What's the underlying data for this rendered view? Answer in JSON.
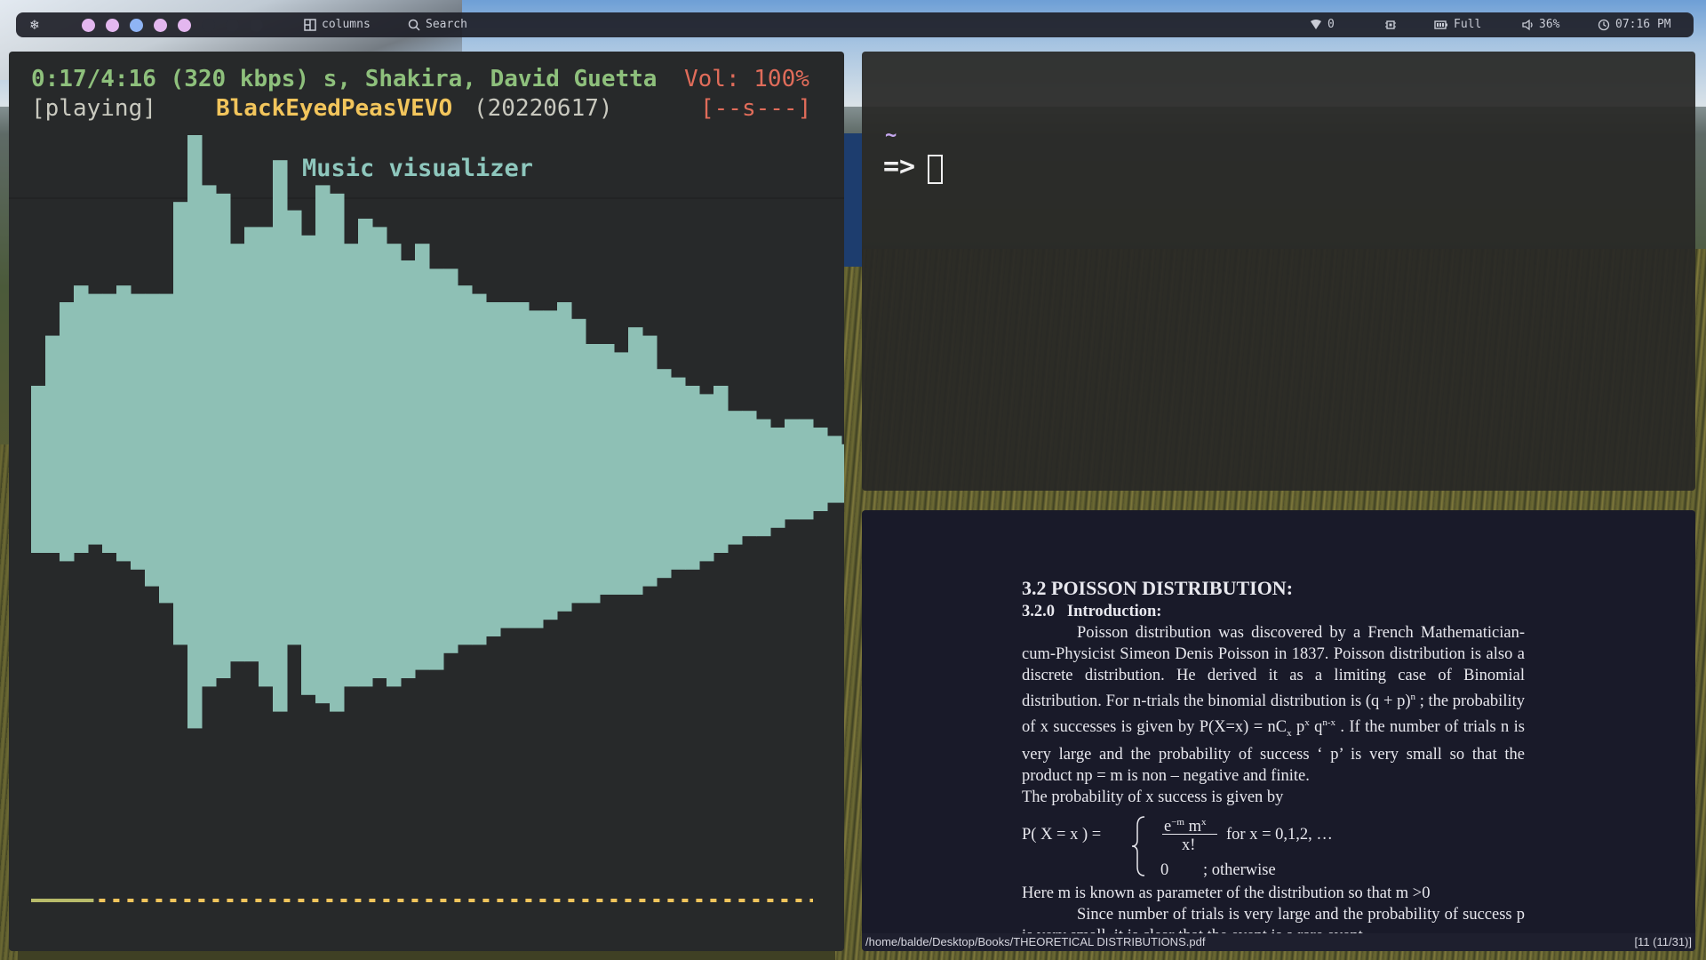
{
  "topbar": {
    "logo_icon": "nix-snowflake-icon",
    "workspaces": [
      {
        "color": "#e3b7ef",
        "active": true
      },
      {
        "color": "#e3b7ef",
        "active": true
      },
      {
        "color": "#8fb4f5",
        "active": true
      },
      {
        "color": "#e3b7ef",
        "active": true
      },
      {
        "color": "#e3b7ef",
        "active": true
      },
      {
        "color": "#2b2d36",
        "active": false
      },
      {
        "color": "#2b2d36",
        "active": false
      },
      {
        "color": "#2b2d36",
        "active": false
      }
    ],
    "layout_label": "columns",
    "search_label": "Search",
    "wifi_label": "0",
    "battery_label": "Full",
    "volume_label": "36%",
    "clock_label": "07:16 PM"
  },
  "player": {
    "time": "0:17/4:16",
    "bitrate": "(320 kbps)",
    "title": "s, Shakira, David Guetta",
    "volume": "Vol: 100%",
    "status": "[playing]",
    "artist": "BlackEyedPeasVEVO",
    "date": "(20220617)",
    "flags": "[--s---]",
    "visualizer_title": "Music visualizer",
    "visualizer_color": "#8ec0b5",
    "progress_fraction": 0.08,
    "bars_top": [
      0.4,
      0.34,
      0.3,
      0.28,
      0.29,
      0.29,
      0.28,
      0.29,
      0.29,
      0.29,
      0.18,
      0.1,
      0.16,
      0.17,
      0.23,
      0.21,
      0.21,
      0.13,
      0.19,
      0.22,
      0.16,
      0.17,
      0.23,
      0.2,
      0.21,
      0.23,
      0.25,
      0.23,
      0.26,
      0.26,
      0.28,
      0.29,
      0.3,
      0.3,
      0.3,
      0.31,
      0.31,
      0.3,
      0.32,
      0.35,
      0.35,
      0.36,
      0.33,
      0.34,
      0.38,
      0.39,
      0.4,
      0.41,
      0.4,
      0.43,
      0.43,
      0.44,
      0.45,
      0.44,
      0.44,
      0.45,
      0.46,
      0.47,
      0.47,
      0.48,
      0.49,
      0.5,
      0.51,
      0.52,
      0.53,
      0.54,
      0.55,
      0.56,
      0.57,
      0.58,
      0.59,
      0.6,
      0.61,
      0.62,
      0.63
    ],
    "bars_bottom": [
      0.6,
      0.6,
      0.61,
      0.6,
      0.59,
      0.6,
      0.61,
      0.62,
      0.64,
      0.66,
      0.71,
      0.81,
      0.76,
      0.75,
      0.73,
      0.73,
      0.76,
      0.79,
      0.71,
      0.77,
      0.78,
      0.79,
      0.76,
      0.76,
      0.75,
      0.76,
      0.75,
      0.74,
      0.74,
      0.72,
      0.71,
      0.71,
      0.7,
      0.69,
      0.69,
      0.69,
      0.68,
      0.67,
      0.66,
      0.66,
      0.65,
      0.65,
      0.65,
      0.64,
      0.63,
      0.62,
      0.62,
      0.61,
      0.6,
      0.59,
      0.58,
      0.58,
      0.57,
      0.56,
      0.56,
      0.55,
      0.54,
      0.54,
      0.53,
      0.53,
      0.52,
      0.52,
      0.51,
      0.51,
      0.51,
      0.51,
      0.51,
      0.51,
      0.51,
      0.51,
      0.51,
      0.51,
      0.51,
      0.51,
      0.51
    ]
  },
  "terminal": {
    "cwd": "~",
    "prompt": "=>"
  },
  "pdf": {
    "heading": "3.2 POISSON DISTRIBUTION:",
    "subheading_num": "3.2.0",
    "subheading": "Introduction:",
    "para1": "Poisson distribution was discovered by a French Mathematician-cum-Physicist Simeon Denis Poisson in 1837. Poisson distribution is also a discrete distribution. He derived it as a limiting case of Binomial distribution. For n-trials the binomial distribution is (q + p)",
    "para1_sup": "n",
    "para1b": " ; the probability of x successes is given by P(X=x)  = nC",
    "para1b_sub": "x",
    "para1c": " p",
    "para1c_sup": "x",
    "para1d": " q",
    "para1d_sup": "n-x",
    "para1e": " . If the number of trials n is very large and the probability of success ‘ p’  is very small so that the product np = m is non – negative and finite.",
    "para2": "The probability of x success is given by",
    "formula_lhs": "P( X = x )  =",
    "formula_num": "e",
    "formula_num_sup": "−m",
    "formula_num2": " m",
    "formula_num2_sup": "x",
    "formula_den": "x!",
    "formula_case1": "for x = 0,1,2, …",
    "formula_zero": "0",
    "formula_case2": ";  otherwise",
    "para3": "Here m is known as parameter of the distribution so that m >0",
    "para4": "Since number of trials is very large and the probability of success p is very small, it is clear that the event is a rare event.",
    "status_path": "/home/balde/Desktop/Books/THEORETICAL DISTRIBUTIONS.pdf",
    "status_page": "[11 (11/31)]"
  }
}
